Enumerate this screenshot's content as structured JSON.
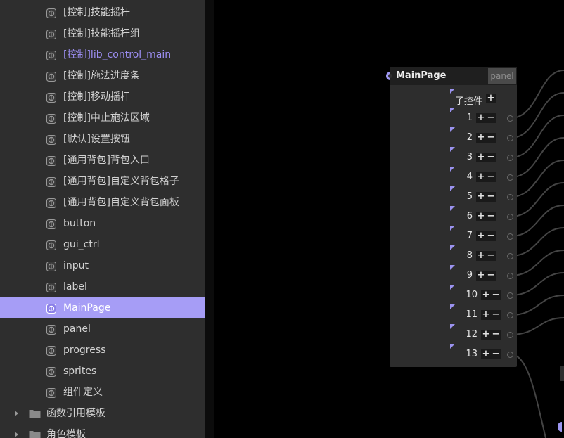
{
  "sidebar": {
    "items": [
      {
        "label": "[控制]技能摇杆",
        "accent": false,
        "selected": false
      },
      {
        "label": "[控制]技能摇杆组",
        "accent": false,
        "selected": false
      },
      {
        "label": "[控制]lib_control_main",
        "accent": true,
        "selected": false
      },
      {
        "label": "[控制]施法进度条",
        "accent": false,
        "selected": false
      },
      {
        "label": "[控制]移动摇杆",
        "accent": false,
        "selected": false
      },
      {
        "label": "[控制]中止施法区域",
        "accent": false,
        "selected": false
      },
      {
        "label": "[默认]设置按钮",
        "accent": false,
        "selected": false
      },
      {
        "label": "[通用背包]背包入口",
        "accent": false,
        "selected": false
      },
      {
        "label": "[通用背包]自定义背包格子",
        "accent": false,
        "selected": false
      },
      {
        "label": "[通用背包]自定义背包面板",
        "accent": false,
        "selected": false
      },
      {
        "label": "button",
        "accent": false,
        "selected": false
      },
      {
        "label": "gui_ctrl",
        "accent": false,
        "selected": false
      },
      {
        "label": "input",
        "accent": false,
        "selected": false
      },
      {
        "label": "label",
        "accent": false,
        "selected": false
      },
      {
        "label": "MainPage",
        "accent": false,
        "selected": true
      },
      {
        "label": "panel",
        "accent": false,
        "selected": false
      },
      {
        "label": "progress",
        "accent": false,
        "selected": false
      },
      {
        "label": "sprites",
        "accent": false,
        "selected": false
      },
      {
        "label": "组件定义",
        "accent": false,
        "selected": false
      }
    ],
    "folders": [
      {
        "label": "函数引用模板"
      },
      {
        "label": "角色模板"
      }
    ],
    "item_icon": "component-icon",
    "folder_icon": "folder-icon",
    "colors": {
      "selected_bg": "#a69df6",
      "accent_text": "#9c8ef2"
    }
  },
  "node": {
    "title": "MainPage",
    "type": "panel",
    "children_label": "子控件",
    "add_symbol": "+",
    "remove_symbol": "−",
    "rows": [
      "1",
      "2",
      "3",
      "4",
      "5",
      "6",
      "7",
      "8",
      "9",
      "10",
      "11",
      "12",
      "13"
    ]
  }
}
